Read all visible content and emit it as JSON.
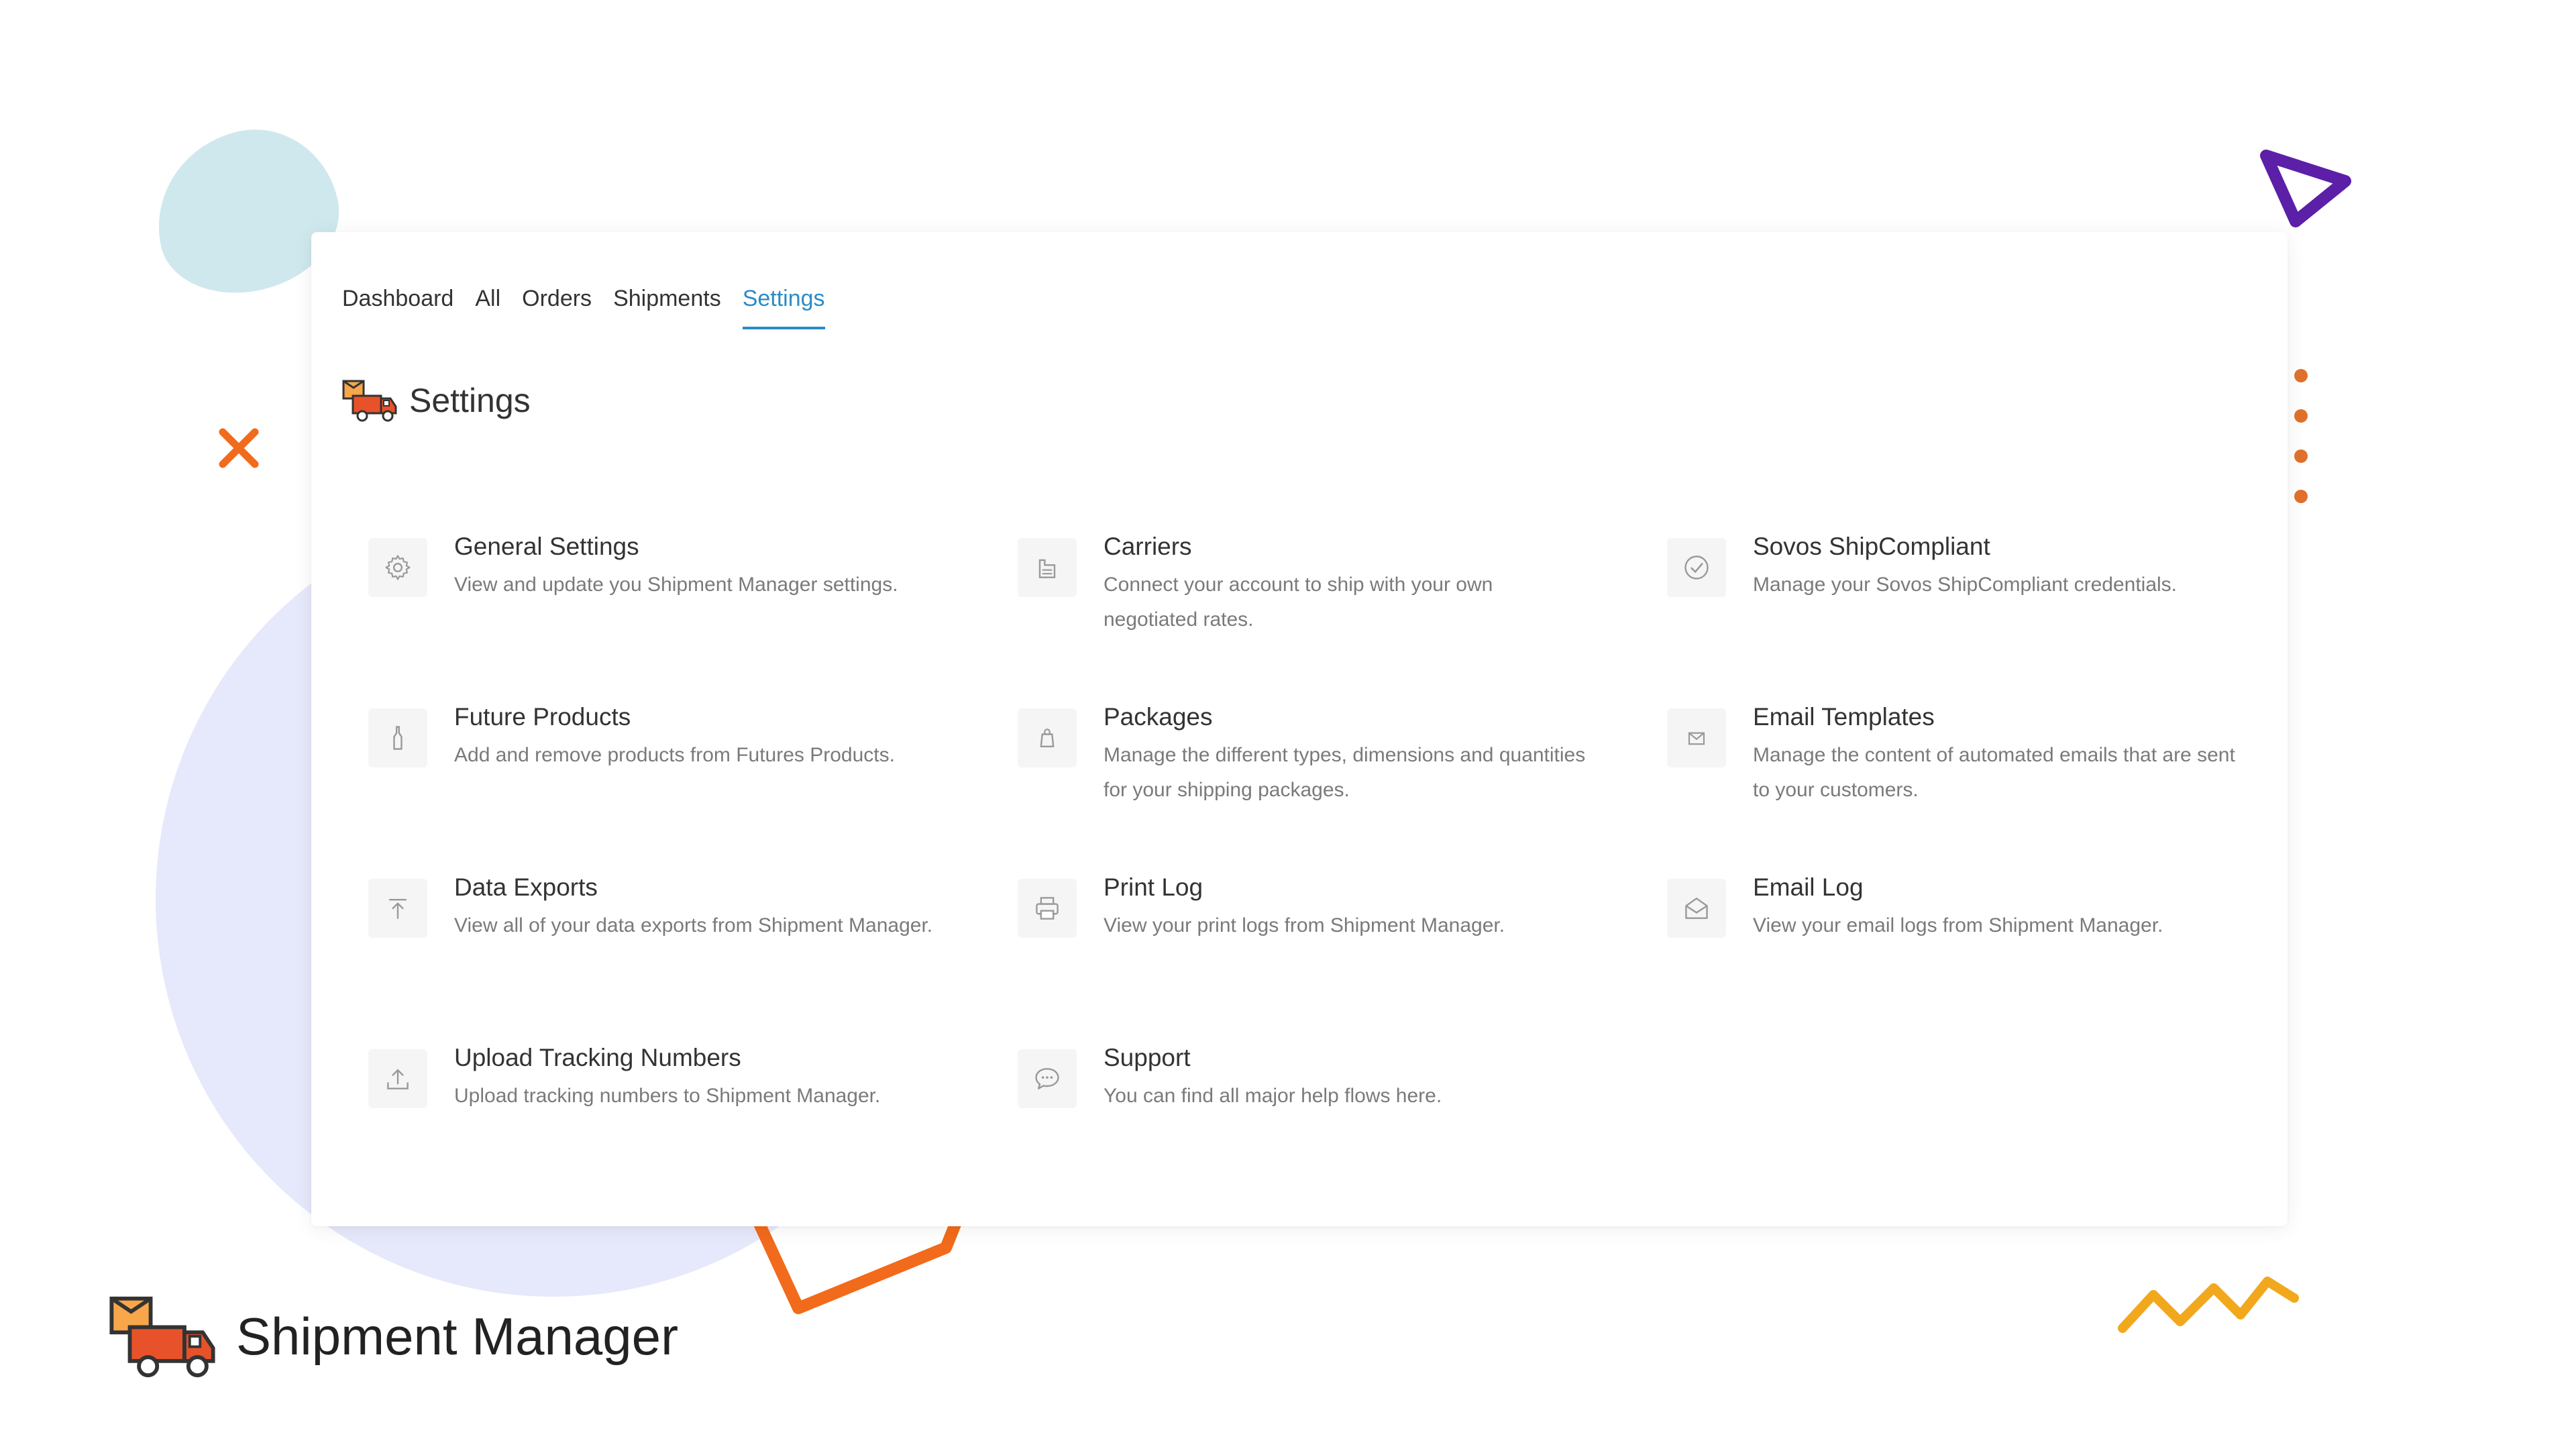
{
  "tabs": [
    {
      "label": "Dashboard",
      "active": false
    },
    {
      "label": "All",
      "active": false
    },
    {
      "label": "Orders",
      "active": false
    },
    {
      "label": "Shipments",
      "active": false
    },
    {
      "label": "Settings",
      "active": true
    }
  ],
  "page": {
    "title": "Settings"
  },
  "settings": [
    {
      "icon": "gear-icon",
      "title": "General Settings",
      "description": "View and update you Shipment Manager settings."
    },
    {
      "icon": "warehouse-icon",
      "title": "Carriers",
      "description": "Connect your account to ship with your own negotiated rates."
    },
    {
      "icon": "check-circle-icon",
      "title": "Sovos ShipCompliant",
      "description": "Manage your Sovos ShipCompliant credentials."
    },
    {
      "icon": "bottle-icon",
      "title": "Future Products",
      "description": "Add and remove products from Futures Products."
    },
    {
      "icon": "package-icon",
      "title": "Packages",
      "description": "Manage the different types, dimensions and quantities for your shipping packages."
    },
    {
      "icon": "envelope-icon",
      "title": "Email Templates",
      "description": "Manage the content of automated emails that are sent to your customers."
    },
    {
      "icon": "export-icon",
      "title": "Data Exports",
      "description": "View all of your data exports from Shipment Manager."
    },
    {
      "icon": "printer-icon",
      "title": "Print Log",
      "description": "View your print logs from Shipment Manager."
    },
    {
      "icon": "envelope-open-icon",
      "title": "Email Log",
      "description": "View your email logs from Shipment Manager."
    },
    {
      "icon": "upload-icon",
      "title": "Upload Tracking Numbers",
      "description": "Upload tracking numbers to Shipment Manager."
    },
    {
      "icon": "chat-bubble-icon",
      "title": "Support",
      "description": "You can find all major help flows here."
    }
  ],
  "brand": {
    "name": "Shipment Manager"
  },
  "colors": {
    "accent": "#2a8cc7",
    "orange": "#f26a1b",
    "purple": "#5b1fa8",
    "yellow": "#f2a81d",
    "teal_blob": "#cfe8ed",
    "lavender": "#e6e9fb"
  }
}
